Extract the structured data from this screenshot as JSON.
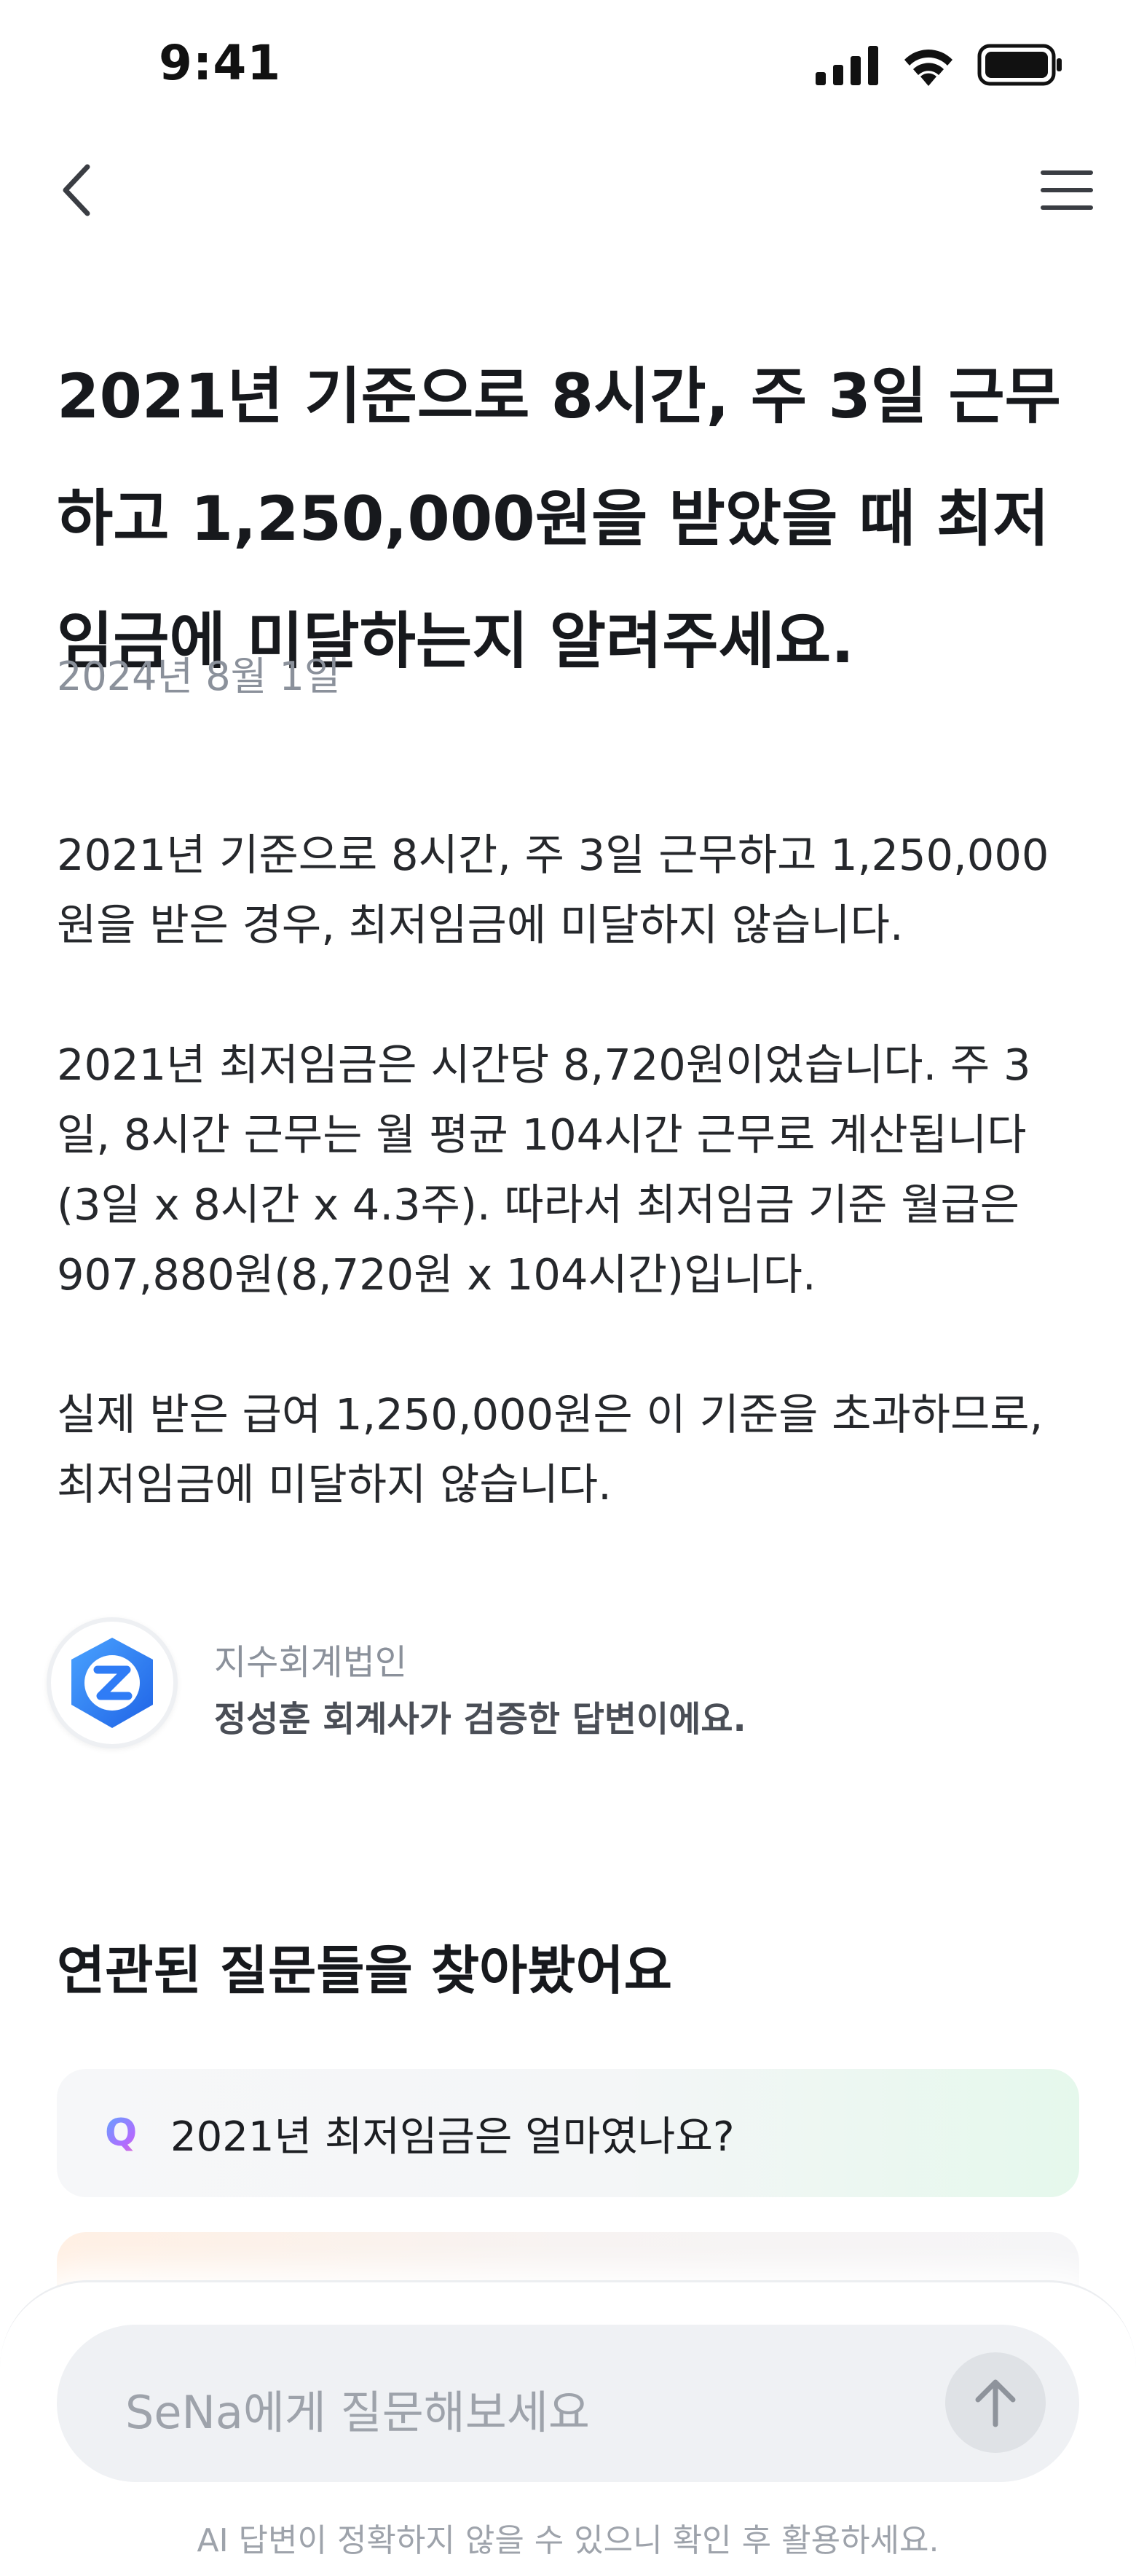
{
  "status_bar": {
    "time": "9:41"
  },
  "question": {
    "title": "2021년 기준으로 8시간, 주 3일 근무\n하고 1,250,000원을 받았을 때 최저\n임금에 미달하는지 알려주세요.",
    "date": "2024년 8월 1일"
  },
  "answer": {
    "paragraphs": [
      "2021년 기준으로 8시간, 주 3일 근무하고 1,250,000\n원을 받은 경우, 최저임금에 미달하지 않습니다.",
      "2021년 최저임금은 시간당 8,720원이었습니다. 주 3\n일, 8시간 근무는 월 평균 104시간 근무로 계산됩니다\n(3일 x 8시간 x 4.3주). 따라서 최저임금 기준 월급은\n907,880원(8,720원 x 104시간)입니다.",
      "실제 받은 급여 1,250,000원은 이 기준을 초과하므로,\n최저임금에 미달하지 않습니다."
    ]
  },
  "verifier": {
    "firm": "지수회계법인",
    "note": "정성훈 회계사가 검증한 답변이에요."
  },
  "related": {
    "title": "연관된 질문들을 찾아봤어요",
    "items": [
      {
        "marker": "Q",
        "text": "2021년 최저임금은 얼마였나요?"
      }
    ]
  },
  "composer": {
    "placeholder": "SeNa에게 질문해보세요",
    "disclaimer": "AI 답변이 정확하지 않을 수 있으니 확인 후 활용하세요."
  },
  "icons": {
    "back": "chevron-left-icon",
    "menu": "hamburger-menu-icon",
    "send": "arrow-up-icon",
    "signal": "cellular-signal-icon",
    "wifi": "wifi-icon",
    "battery": "battery-icon"
  },
  "colors": {
    "brand_blue": "#2f7cf6",
    "date_gray": "#8b919b",
    "input_bg": "#eff1f4"
  }
}
